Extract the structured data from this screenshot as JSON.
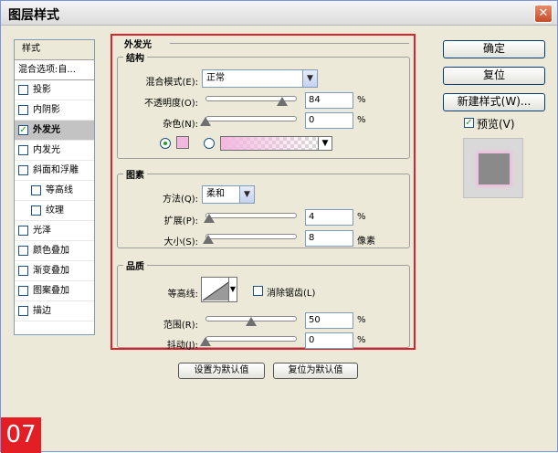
{
  "window": {
    "title": "图层样式",
    "close": "✕"
  },
  "style_list": {
    "header": "样式",
    "blend_options": "混合选项:自...",
    "items": [
      {
        "label": "投影",
        "checked": false,
        "sub": false
      },
      {
        "label": "内阴影",
        "checked": false,
        "sub": false
      },
      {
        "label": "外发光",
        "checked": true,
        "sub": false,
        "selected": true
      },
      {
        "label": "内发光",
        "checked": false,
        "sub": false
      },
      {
        "label": "斜面和浮雕",
        "checked": false,
        "sub": false
      },
      {
        "label": "等高线",
        "checked": false,
        "sub": true
      },
      {
        "label": "纹理",
        "checked": false,
        "sub": true
      },
      {
        "label": "光泽",
        "checked": false,
        "sub": false
      },
      {
        "label": "颜色叠加",
        "checked": false,
        "sub": false
      },
      {
        "label": "渐变叠加",
        "checked": false,
        "sub": false
      },
      {
        "label": "图案叠加",
        "checked": false,
        "sub": false
      },
      {
        "label": "描边",
        "checked": false,
        "sub": false
      }
    ]
  },
  "outer_glow": {
    "section_title": "外发光",
    "structure": {
      "title": "结构",
      "blend_mode_label": "混合模式(E):",
      "blend_mode_value": "正常",
      "opacity_label": "不透明度(O):",
      "opacity_value": "84",
      "opacity_fraction": 0.84,
      "opacity_unit": "%",
      "noise_label": "杂色(N):",
      "noise_value": "0",
      "noise_fraction": 0,
      "noise_unit": "%",
      "color_mode": "solid",
      "glow_color": "#f3b8df"
    },
    "elements": {
      "title": "图素",
      "technique_label": "方法(Q):",
      "technique_value": "柔和",
      "spread_label": "扩展(P):",
      "spread_value": "4",
      "spread_fraction": 0.04,
      "spread_unit": "%",
      "size_label": "大小(S):",
      "size_value": "8",
      "size_fraction": 0.032,
      "size_unit": "像素"
    },
    "quality": {
      "title": "品质",
      "contour_label": "等高线:",
      "antialias_label": "消除锯齿(L)",
      "antialias_checked": false,
      "range_label": "范围(R):",
      "range_value": "50",
      "range_fraction": 0.5,
      "range_unit": "%",
      "jitter_label": "抖动(J):",
      "jitter_value": "0",
      "jitter_fraction": 0,
      "jitter_unit": "%"
    },
    "make_default": "设置为默认值",
    "reset_default": "复位为默认值"
  },
  "actions": {
    "ok": "确定",
    "reset": "复位",
    "new_style": "新建样式(W)...",
    "preview_label": "预览(V)",
    "preview_checked": true
  },
  "badge": "07",
  "colors": {
    "accent_red": "#e0202a",
    "glow_pink": "#f3b8df"
  }
}
